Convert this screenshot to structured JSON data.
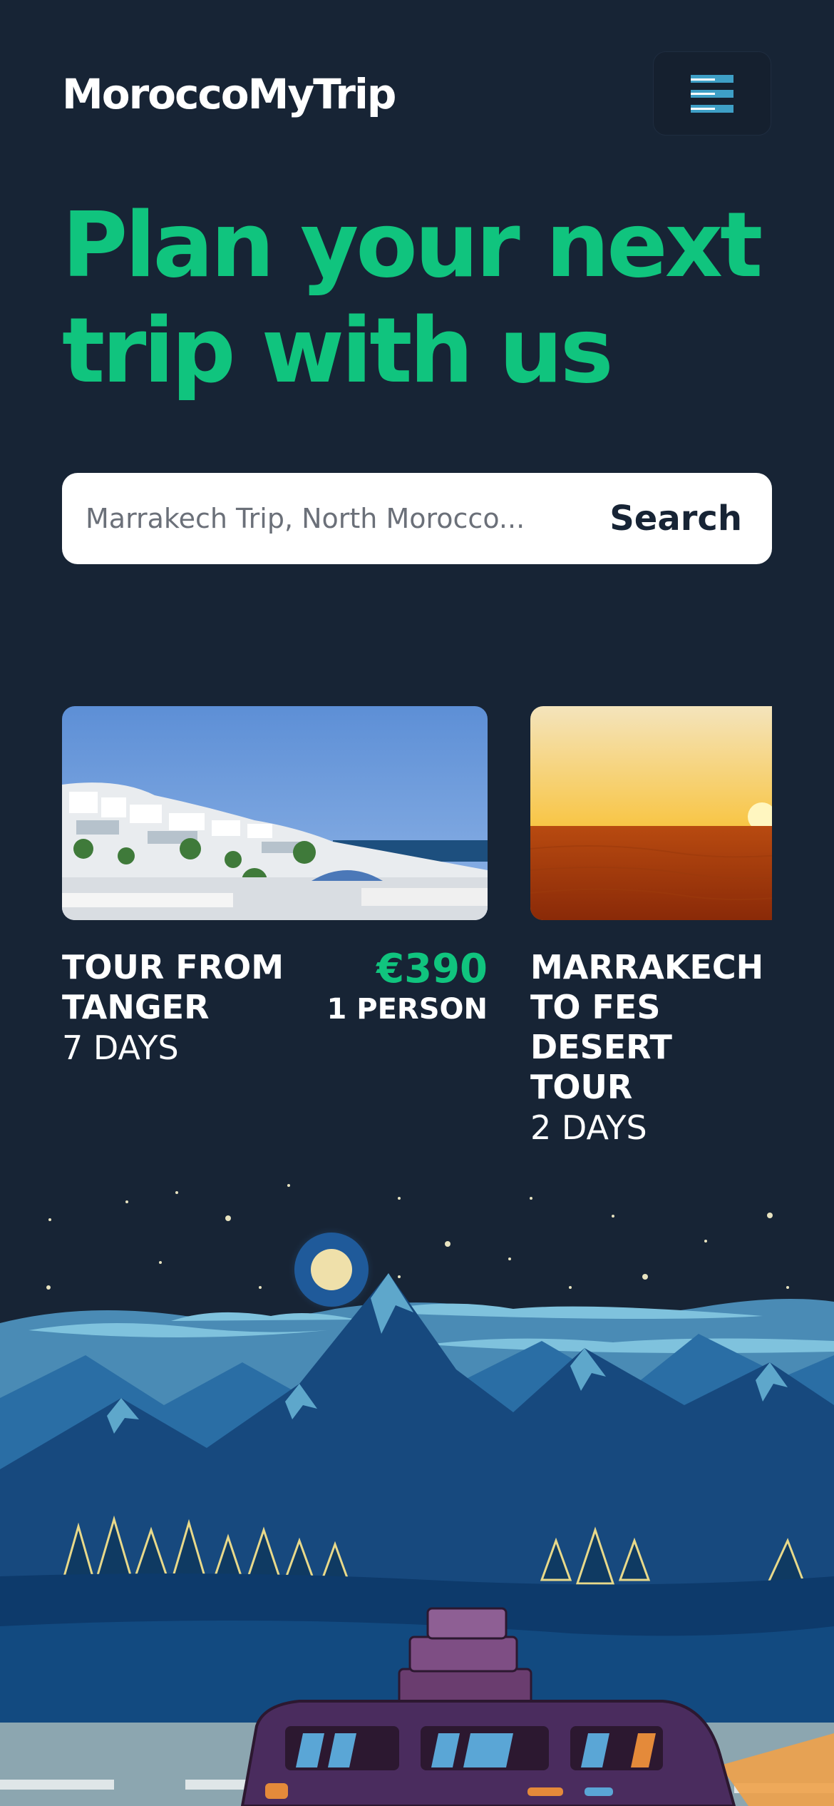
{
  "brand": {
    "name": "MoroccoMyTrip"
  },
  "hero": {
    "line1": "Plan your next",
    "line2": "trip with us"
  },
  "search": {
    "placeholder": "Marrakech Trip, North Morocco...",
    "button_label": "Search"
  },
  "tours": [
    {
      "title_line1": "TOUR FROM",
      "title_line2": "TANGER",
      "duration": "7 DAYS",
      "price": "€390",
      "persons": "1 PERSON"
    },
    {
      "title_line1": "MARRAKECH",
      "title_line2": "TO FES",
      "title_line3": "DESERT",
      "title_line4": "TOUR",
      "duration": "2 DAYS"
    }
  ],
  "icons": {
    "menu": "hamburger-menu-icon"
  },
  "colors": {
    "background": "#172435",
    "accent": "#10c47e",
    "text": "#ffffff"
  }
}
